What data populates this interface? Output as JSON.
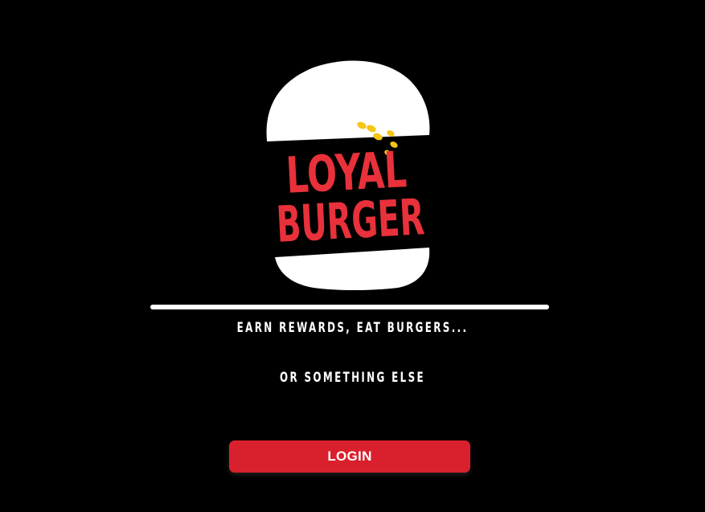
{
  "logo": {
    "line1": "LOYAL",
    "line2": "BURGER"
  },
  "tagline": {
    "line1": "EARN REWARDS, EAT BURGERS...",
    "line2": "OR SOMETHING ELSE"
  },
  "login_button": {
    "label": "LOGIN"
  },
  "colors": {
    "background": "#000000",
    "accent": "#d9212d",
    "logo_text": "#e8313b",
    "sesame": "#f5c518",
    "bun": "#ffffff"
  }
}
